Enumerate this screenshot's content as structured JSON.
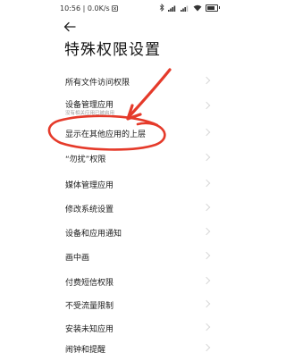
{
  "status_bar": {
    "time": "10:56",
    "speed": "0.0K/s",
    "battery_level": 0.8
  },
  "header": {
    "title": "特殊权限设置"
  },
  "items": [
    {
      "label": "所有文件访问权限"
    },
    {
      "label": "设备管理应用",
      "subtitle": "没有相关应用已被启用"
    },
    {
      "label": "显示在其他应用的上层"
    },
    {
      "label": "“勿扰”权限"
    },
    {
      "label": "媒体管理应用"
    },
    {
      "label": "修改系统设置"
    },
    {
      "label": "设备和应用通知"
    },
    {
      "label": "画中画"
    },
    {
      "label": "付费短信权限"
    },
    {
      "label": "不受流量限制"
    },
    {
      "label": "安装未知应用"
    },
    {
      "label": "闹钟和提醒"
    }
  ],
  "annotation_color": "#e53a2a"
}
